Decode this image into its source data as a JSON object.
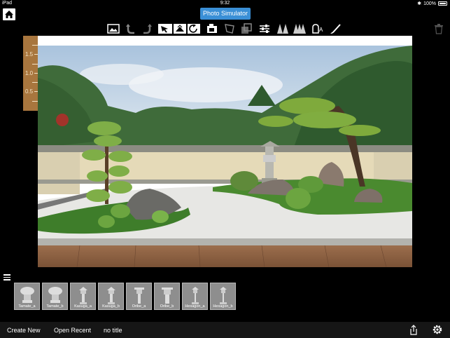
{
  "status": {
    "device": "iPad",
    "time": "9:32",
    "battery": "100%"
  },
  "app": {
    "title": "Photo Simulator"
  },
  "toolbar": {
    "icons": [
      "photo-icon",
      "undo-icon",
      "redo-icon",
      "select-icon",
      "flip-icon",
      "rotate-icon",
      "camera-icon",
      "perspective-icon",
      "layer-icon",
      "adjust-icon",
      "single-tree-icon",
      "double-tree-icon",
      "eraser-icon",
      "brush-icon"
    ]
  },
  "ruler": {
    "labels": [
      "1.5",
      "1.0",
      "0.5"
    ]
  },
  "tray": {
    "items": [
      "Tamate_a",
      "Tamate_b",
      "Kasuga_a",
      "Kasuga_b",
      "Oribe_a",
      "Oribe_b",
      "Hexagon_a",
      "Hexagon_b"
    ]
  },
  "bottom": {
    "create_new": "Create New",
    "open_recent": "Open Recent",
    "file_name": "no title"
  }
}
